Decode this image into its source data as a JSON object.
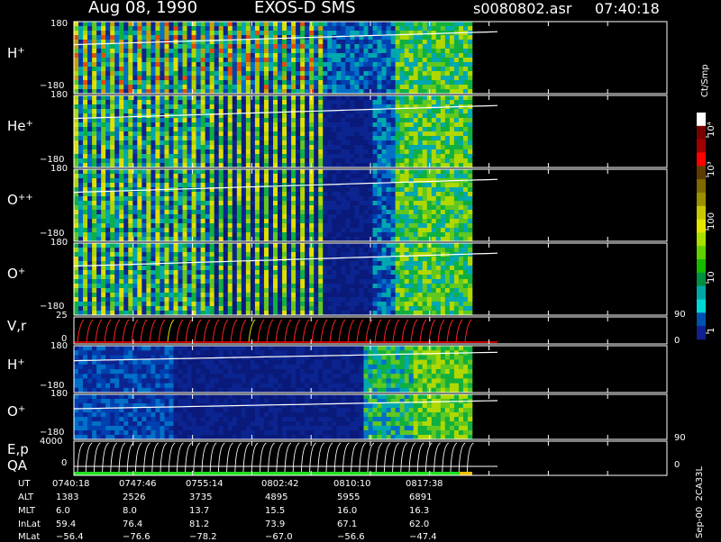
{
  "header": {
    "date": "Aug 08, 1990",
    "instrument": "EXOS-D SMS",
    "file": "s0080802.asr",
    "time": "07:40:18"
  },
  "panels": [
    {
      "label": "H",
      "sup": "+",
      "ymax": "180",
      "ymin": "−180"
    },
    {
      "label": "He",
      "sup": "+",
      "ymax": "180",
      "ymin": "−180"
    },
    {
      "label": "O",
      "sup": "++",
      "ymax": "180",
      "ymin": "−180"
    },
    {
      "label": "O",
      "sup": "+",
      "ymax": "180",
      "ymin": "−180"
    },
    {
      "label": "V,r",
      "sup": "",
      "ymax": "25",
      "ymin": "0",
      "right_top": "90",
      "right_bottom": "0"
    },
    {
      "label": "H",
      "sup": "+",
      "ymax": "180",
      "ymin": "−180"
    },
    {
      "label": "O",
      "sup": "+",
      "ymax": "180",
      "ymin": "−180"
    },
    {
      "label": "E,p",
      "label2": "QA",
      "sup": "",
      "ymax": "4000",
      "ymin": "0",
      "right_top": "90",
      "right_bottom": "0"
    }
  ],
  "colorbar": {
    "unit": "Ct/Smp",
    "ticks": [
      "10⁴",
      "10³",
      "100",
      "10",
      "1"
    ],
    "colors": [
      "#ffffff",
      "#7a0000",
      "#a00000",
      "#ff0000",
      "#5e3b00",
      "#7f6a00",
      "#9a9000",
      "#c8c800",
      "#e5e500",
      "#a8e000",
      "#60d000",
      "#18b800",
      "#009040",
      "#00a8a8",
      "#00d8d8",
      "#0050b0",
      "#102090"
    ]
  },
  "footer": {
    "row_labels": [
      "UT",
      "ALT",
      "MLT",
      "InLat",
      "MLat"
    ],
    "columns": [
      {
        "UT": "0740:18",
        "ALT": "1383",
        "MLT": "6.0",
        "InLat": "59.4",
        "MLat": "−56.4"
      },
      {
        "UT": "0747:46",
        "ALT": "2526",
        "MLT": "8.0",
        "InLat": "76.4",
        "MLat": "−76.6"
      },
      {
        "UT": "0755:14",
        "ALT": "3735",
        "MLT": "13.7",
        "InLat": "81.2",
        "MLat": "−78.2"
      },
      {
        "UT": "0802:42",
        "ALT": "4895",
        "MLT": "15.5",
        "InLat": "73.9",
        "MLat": "−67.0"
      },
      {
        "UT": "0810:10",
        "ALT": "5955",
        "MLT": "16.0",
        "InLat": "67.1",
        "MLat": "−56.6"
      },
      {
        "UT": "0817:38",
        "ALT": "6891",
        "MLT": "16.3",
        "InLat": "62.0",
        "MLat": "−47.4"
      }
    ],
    "side_label": "Sep-00  2CA33L"
  },
  "chart_data": {
    "type": "heatmap",
    "title": "Aug 08, 1990   EXOS-D SMS",
    "x_ticks": [
      "0740:18",
      "0747:46",
      "0755:14",
      "0802:42",
      "0810:10",
      "0817:38"
    ],
    "panels": [
      {
        "name": "H+",
        "ylim": [
          -180,
          180
        ]
      },
      {
        "name": "He+",
        "ylim": [
          -180,
          180
        ]
      },
      {
        "name": "O++",
        "ylim": [
          -180,
          180
        ]
      },
      {
        "name": "O+",
        "ylim": [
          -180,
          180
        ]
      },
      {
        "name": "V,r",
        "ylim": [
          0,
          25
        ],
        "y2lim": [
          0,
          90
        ]
      },
      {
        "name": "H+",
        "ylim": [
          -180,
          180
        ]
      },
      {
        "name": "O+",
        "ylim": [
          -180,
          180
        ]
      },
      {
        "name": "E,p",
        "ylim": [
          0,
          4000
        ],
        "y2lim": [
          0,
          90
        ]
      }
    ],
    "colorbar": {
      "label": "Ct/Smp",
      "scale": "log",
      "range": [
        1,
        10000
      ]
    }
  }
}
